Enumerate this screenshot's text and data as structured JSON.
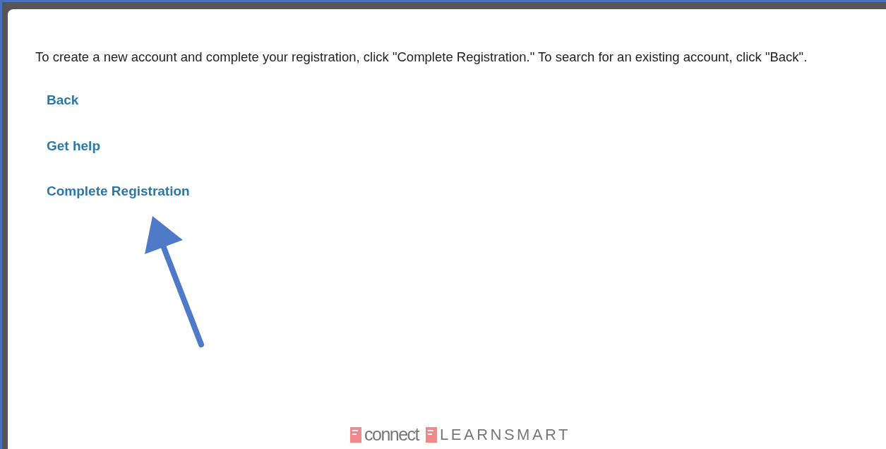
{
  "instructions": "To create a new account and complete your registration, click \"Complete Registration.\" To search for an existing account, click \"Back\".",
  "links": [
    {
      "label": "Back"
    },
    {
      "label": "Get help"
    },
    {
      "label": "Complete Registration"
    }
  ],
  "logos": [
    {
      "kind": "rounded",
      "text": "connect"
    },
    {
      "kind": "spaced",
      "text": "LEARNSMART"
    }
  ]
}
